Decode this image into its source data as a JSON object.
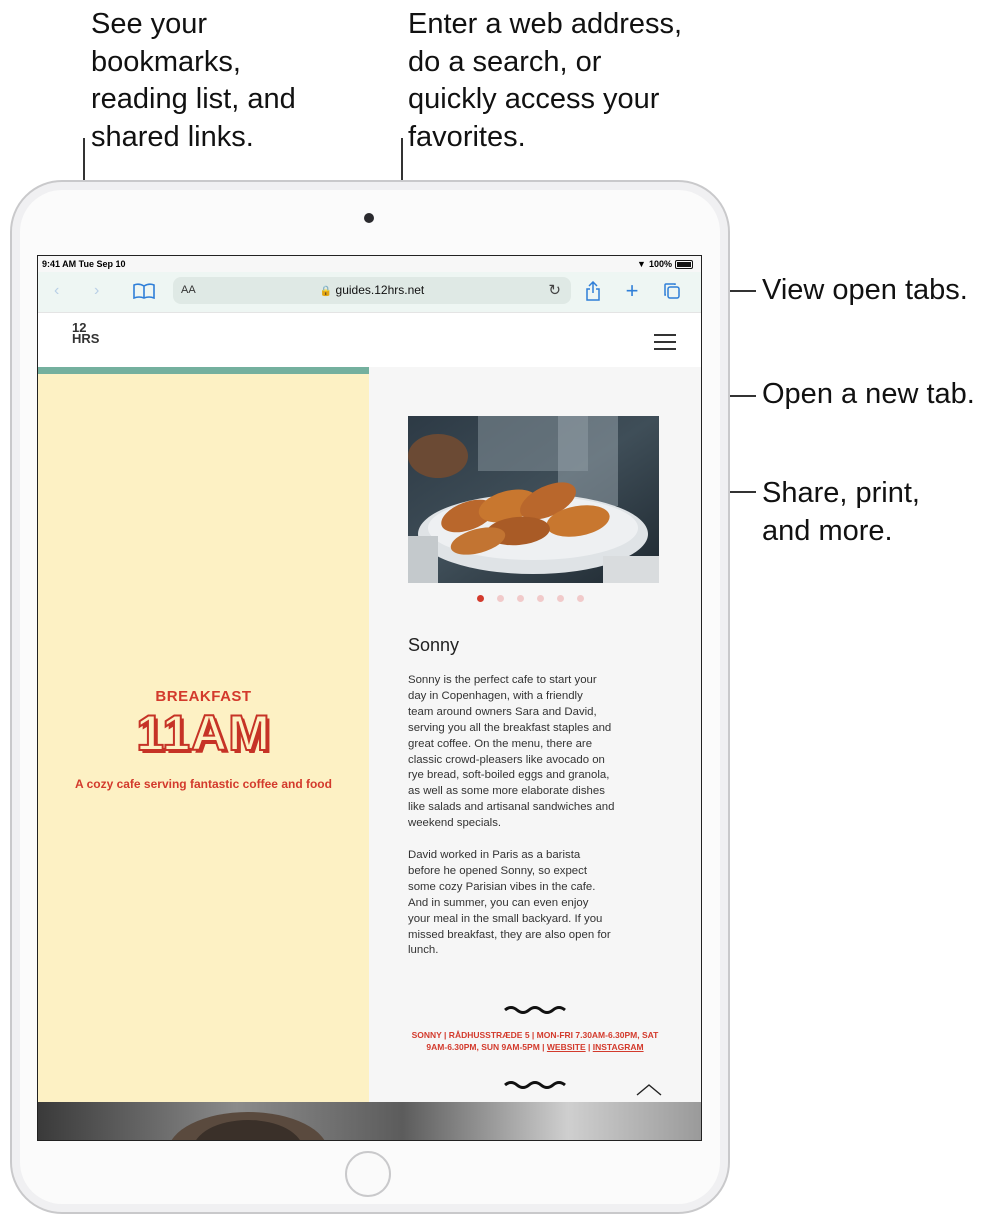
{
  "callouts": {
    "bookmarks": "See your\nbookmarks,\nreading list, and\nshared links.",
    "address": "Enter a web address,\ndo a search, or\nquickly access your\nfavorites.",
    "tabs": "View open tabs.",
    "new_tab": "Open a new tab.",
    "share": "Share, print,\nand more."
  },
  "status_bar": {
    "time": "9:41 AM  Tue Sep 10",
    "battery": "100%"
  },
  "toolbar": {
    "text_size_label": "AA",
    "url": "guides.12hrs.net",
    "icons": [
      "back-icon",
      "forward-icon",
      "bookmarks-icon",
      "lock-icon",
      "reload-icon",
      "share-icon",
      "new-tab-icon",
      "tabs-icon"
    ]
  },
  "site": {
    "logo_top": "12",
    "logo_bottom": "HRS",
    "breakfast_label": "BREAKFAST",
    "time": "11AM",
    "subtitle": "A cozy cafe serving fantastic coffee and food",
    "cafe_name": "Sonny",
    "paragraph1": "Sonny is the perfect cafe to start your\nday in Copenhagen, with a friendly\nteam around owners Sara and David,\nserving you all the breakfast staples and\ngreat coffee. On the menu, there are\nclassic crowd-pleasers like avocado on\nrye bread, soft-boiled eggs and granola,\nas well as some more elaborate dishes\nlike salads and artisanal sandwiches and\nweekend specials.",
    "paragraph2": "David worked in Paris as a barista\nbefore he opened Sonny, so expect\nsome cozy Parisian vibes in the cafe.\nAnd in summer, you can even enjoy\nyour meal in the small backyard. If you\nmissed breakfast, they are also open for\nlunch.",
    "address_line1": "SONNY | RÅDHUSSTRÆDE 5 | MON-FRI 7.30AM-6.30PM, SAT",
    "address_line2_prefix": "9AM-6.30PM, SUN 9AM-5PM | ",
    "website_link": "WEBSITE",
    "separator": " | ",
    "instagram_link": "INSTAGRAM",
    "carousel_pages": 6,
    "carousel_active": 1
  },
  "colors": {
    "accent_red": "#d33a2c",
    "toolbar_blue": "#2f7fd8",
    "yellow_panel": "#fdf1c4",
    "progress_green": "#74b09e"
  }
}
